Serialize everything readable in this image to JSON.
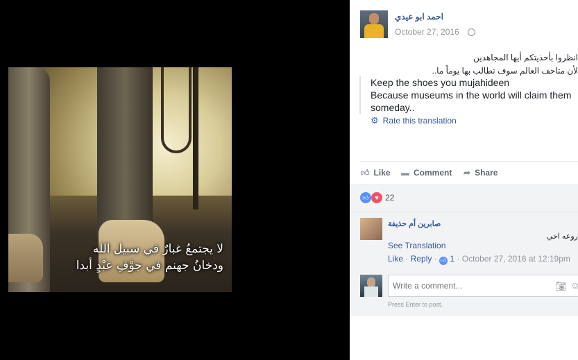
{
  "photo": {
    "caption_line1": "لا يجتمعُ غبارٌ في سبيل الله",
    "caption_line2": "ودخانُ جهنم في جوْفِ عبْدٍ أبدا"
  },
  "post": {
    "author": "احمد ابو عيدي",
    "date": "October 27, 2016",
    "privacy_icon": "globe-icon",
    "arabic_line1": "انظروا بأحذيتكم أيها المجاهدين",
    "arabic_line2": "لأن متاحف العالم سوف تطالب بها يوماً ما..",
    "translation": [
      "Keep the shoes you mujahideen",
      "Because museums in the world will claim them",
      "someday.."
    ],
    "rate_translation": "Rate this translation"
  },
  "actions": {
    "like": "Like",
    "comment": "Comment",
    "share": "Share"
  },
  "reactions": {
    "count": "22",
    "types": [
      "like",
      "love"
    ]
  },
  "comment": {
    "author": "صابرين أم حذيفة",
    "text": "روعه اخي",
    "see_translation": "See Translation",
    "like": "Like",
    "reply": "Reply",
    "like_count": "1",
    "timestamp": "October 27, 2016 at 12:19pm"
  },
  "composer": {
    "placeholder": "Write a comment...",
    "hint": "Press Enter to post."
  },
  "colors": {
    "link": "#365899",
    "accent": "#4267b2",
    "like": "#5890ff",
    "love": "#f25268"
  }
}
